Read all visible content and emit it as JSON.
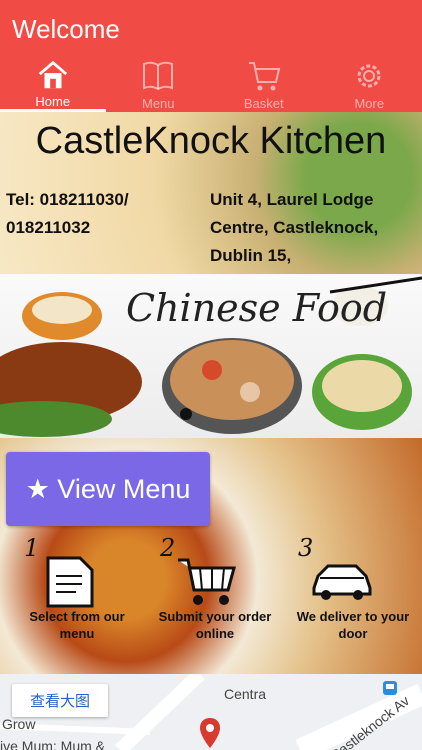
{
  "header": {
    "title": "Welcome",
    "tabs": [
      {
        "label": "Home",
        "icon": "home-icon",
        "active": true
      },
      {
        "label": "Menu",
        "icon": "menu-book-icon",
        "active": false
      },
      {
        "label": "Basket",
        "icon": "basket-cart-icon",
        "active": false
      },
      {
        "label": "More",
        "icon": "gear-icon",
        "active": false
      }
    ]
  },
  "info": {
    "brand": "CastleKnock Kitchen",
    "tel": "Tel: 018211030/ 018211032",
    "address": "Unit 4, Laurel Lodge Centre, Castleknock, Dublin 15,"
  },
  "banner": {
    "script": "Chinese Food"
  },
  "main": {
    "view_menu": "★ View Menu",
    "steps": [
      {
        "num": "1",
        "text": "Select from our menu",
        "icon": "document-icon"
      },
      {
        "num": "2",
        "text": "Submit your order online",
        "icon": "shopping-cart-icon"
      },
      {
        "num": "3",
        "text": "We deliver to your door",
        "icon": "car-icon"
      }
    ]
  },
  "map": {
    "button": "查看大图",
    "label_centra": "Centra",
    "label_grow": "Grow",
    "label_road": "Castleknock Av",
    "label_bottom": "ive Mum: Mum &"
  },
  "colors": {
    "header": "#f04c45",
    "button": "#7b68e6"
  }
}
